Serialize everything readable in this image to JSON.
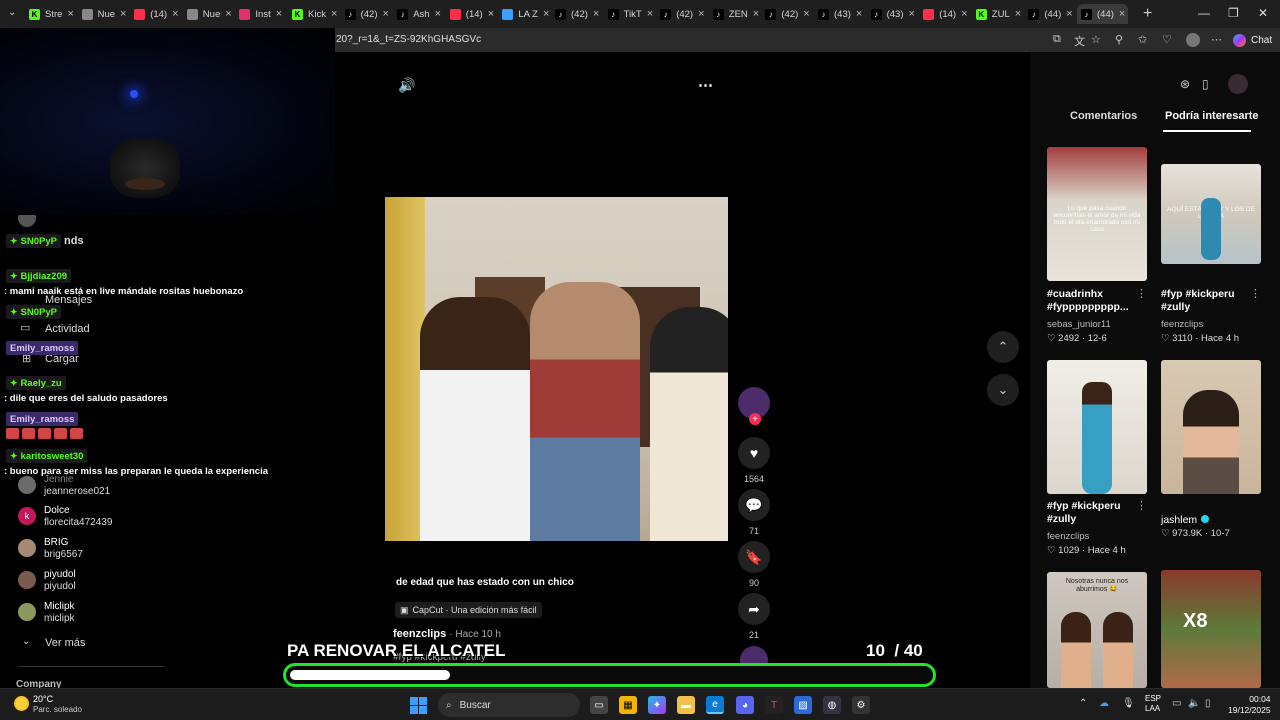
{
  "browser": {
    "tabs": [
      {
        "label": "Stre",
        "icon": "kick-icon",
        "color": "#53fc18"
      },
      {
        "label": "Nue",
        "icon": "page-icon",
        "color": "#888888"
      },
      {
        "label": "(14)",
        "icon": "youtube-icon",
        "color": "#ff2f4a"
      },
      {
        "label": "Nue",
        "icon": "page-icon",
        "color": "#888888"
      },
      {
        "label": "Inst",
        "icon": "instagram-icon",
        "color": "#e1306c"
      },
      {
        "label": "Kick",
        "icon": "kick-icon",
        "color": "#53fc18"
      },
      {
        "label": "(42)",
        "icon": "tiktok-icon",
        "color": "#ffffff"
      },
      {
        "label": "Ash",
        "icon": "tiktok-icon",
        "color": "#ffffff"
      },
      {
        "label": "(14)",
        "icon": "youtube-icon",
        "color": "#ff2f4a"
      },
      {
        "label": "LA Z",
        "icon": "loading-icon",
        "color": "#3aa0ff"
      },
      {
        "label": "(42)",
        "icon": "tiktok-icon",
        "color": "#ffffff"
      },
      {
        "label": "TikT",
        "icon": "tiktok-icon",
        "color": "#ffffff"
      },
      {
        "label": "(42)",
        "icon": "tiktok-icon",
        "color": "#ffffff"
      },
      {
        "label": "ZEN",
        "icon": "tiktok-icon",
        "color": "#ffffff"
      },
      {
        "label": "(42)",
        "icon": "tiktok-icon",
        "color": "#ffffff"
      },
      {
        "label": "(43)",
        "icon": "tiktok-icon",
        "color": "#ffffff"
      },
      {
        "label": "(43)",
        "icon": "tiktok-icon",
        "color": "#ffffff"
      },
      {
        "label": "(14)",
        "icon": "youtube-icon",
        "color": "#ff2f4a"
      },
      {
        "label": "ZUL",
        "icon": "kick-icon",
        "color": "#53fc18"
      },
      {
        "label": "(44)",
        "icon": "tiktok-icon",
        "color": "#ffffff"
      },
      {
        "label": "(44)",
        "icon": "tiktok-icon",
        "color": "#ffffff"
      }
    ],
    "url": "20?_r=1&_t=ZS-92KhGHASGVc",
    "chat_label": "Chat"
  },
  "left": {
    "sidebar": {
      "friends": "nds",
      "mensajes": "Mensajes",
      "actividad": "Actividad",
      "cargar": "Cargar",
      "ver_mas": "Ver más",
      "company": "Company"
    },
    "chat": [
      {
        "user": "SN0PyP",
        "style": "green"
      },
      {
        "user": "Bjjdiaz209",
        "style": "green",
        "msg": ": mami naaik está en live mándale rositas huebonazo"
      },
      {
        "user": "SN0PyP",
        "style": "green"
      },
      {
        "user": "Emily_ramoss",
        "style": "purple"
      },
      {
        "user": "Raely_zu",
        "style": "green",
        "msg": ": dile que eres del saludo pasadores"
      },
      {
        "user": "Emily_ramoss",
        "style": "purple"
      },
      {
        "user": "karitosweet30",
        "style": "green",
        "msg": ": bueno para ser miss las preparan le queda la experiencia"
      }
    ],
    "following": [
      {
        "name": "Jennie",
        "handle": "jeannerose021"
      },
      {
        "name": "Dolce",
        "handle": "florecita472439",
        "initial": "k"
      },
      {
        "name": "BRIG",
        "handle": "brig6567"
      },
      {
        "name": "piyudol",
        "handle": "piyudol"
      },
      {
        "name": "Miclipk",
        "handle": "miclipk"
      }
    ]
  },
  "video": {
    "caption": "de edad que has estado con un chico",
    "capcut": "CapCut · Una edición más fácil",
    "author": "feenzclips",
    "time": "· Hace 10 h",
    "hashtags": "#fyp #kickperu #zully",
    "likes": "1564",
    "comments": "71",
    "saves": "90",
    "shares": "21"
  },
  "overlay": {
    "title": "PA RENOVAR EL ALCATEL",
    "count": "10",
    "total": "/ 40",
    "progress": 0.25
  },
  "right": {
    "tabs": [
      "Comentarios",
      "Podría interesarte"
    ],
    "active_tab": 1,
    "cards": [
      {
        "title": "#cuadrinhx #fyppppppppp...",
        "user": "sebas_junior11",
        "meta": "♡ 2492 · 12-6",
        "thumb_text": "Lo que pasa cuando encuentras el amor de mi vida todo el día enamorado con mi casa"
      },
      {
        "title": "#fyp #kickperu #zully",
        "user": "feenzclips",
        "meta": "♡ 3110 · Hace 4 h",
        "thumb_text": "AQUÍ ESTÁ ZULLY Y LOS DE LA TUYA"
      },
      {
        "title": "#fyp #kickperu #zully",
        "user": "feenzclips",
        "meta": "♡ 1029 · Hace 4 h",
        "thumb_text": ""
      },
      {
        "title": "jashlem",
        "user": "",
        "meta": "♡ 973.9K · 10-7",
        "thumb_text": ""
      },
      {
        "title": "",
        "user": "",
        "meta": "",
        "thumb_text": "Nosotras nunca nos aburrimos 😂"
      },
      {
        "title": "",
        "user": "",
        "meta": "",
        "thumb_text": "X8"
      }
    ]
  },
  "taskbar": {
    "temp": "20°C",
    "weather": "Parc. soleado",
    "search": "Buscar",
    "lang1": "ESP",
    "lang2": "LAA",
    "time": "00:04",
    "date": "19/12/2025"
  }
}
